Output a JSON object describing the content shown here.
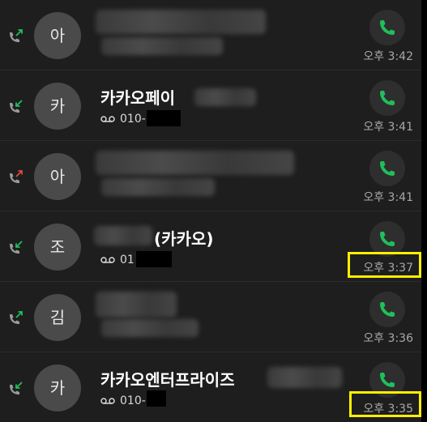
{
  "call_log": {
    "entries": [
      {
        "avatar": "아",
        "direction": "outgoing",
        "direction_icon": "outgoing-call-icon",
        "name": "",
        "number": "",
        "time": "오후 3:42",
        "highlighted": false
      },
      {
        "avatar": "카",
        "direction": "incoming",
        "direction_icon": "incoming-call-icon",
        "name": "카카오페이",
        "number": "010-",
        "time": "오후 3:41",
        "highlighted": false
      },
      {
        "avatar": "아",
        "direction": "missed",
        "direction_icon": "missed-call-icon",
        "name": "",
        "number": "",
        "time": "오후 3:41",
        "highlighted": false
      },
      {
        "avatar": "조",
        "direction": "incoming",
        "direction_icon": "incoming-call-icon",
        "name": "(카카오)",
        "number": "01",
        "time": "오후 3:37",
        "highlighted": true
      },
      {
        "avatar": "김",
        "direction": "outgoing",
        "direction_icon": "outgoing-call-icon",
        "name": "",
        "number": "",
        "time": "오후 3:36",
        "highlighted": false
      },
      {
        "avatar": "카",
        "direction": "incoming",
        "direction_icon": "incoming-call-icon",
        "name": "카카오엔터프라이즈",
        "number": "010-",
        "time": "오후 3:35",
        "highlighted": true
      }
    ]
  },
  "icons": {
    "call_button": "phone-icon",
    "voicemail": "voicemail-icon"
  },
  "colors": {
    "accent_green": "#1fbf5b",
    "missed_red": "#e0483e",
    "highlight": "#ffef00"
  }
}
